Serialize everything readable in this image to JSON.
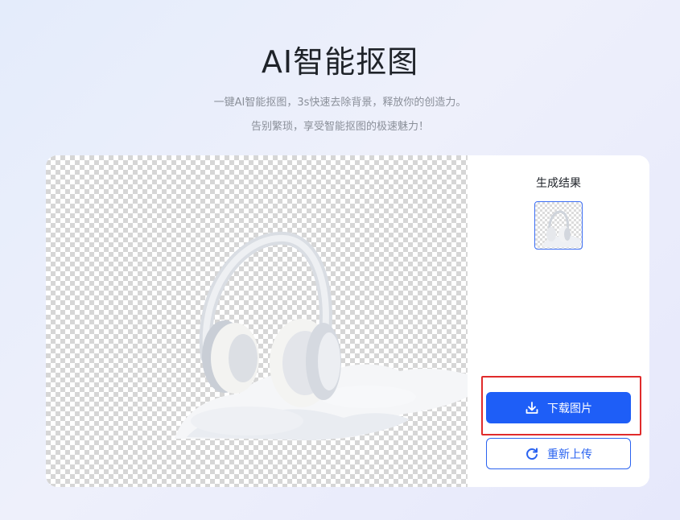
{
  "page": {
    "title": "AI智能抠图",
    "subtitle_line1": "一键AI智能抠图，3s快速去除背景，释放你的创造力。",
    "subtitle_line2": "告别繁琐，享受智能抠图的极速魅力！"
  },
  "result_panel": {
    "title": "生成结果",
    "thumbnail_icon": "headphones-result-thumbnail"
  },
  "actions": {
    "download_label": "下载图片",
    "download_icon": "download-icon",
    "reupload_label": "重新上传",
    "reupload_icon": "refresh-icon"
  },
  "colors": {
    "primary": "#1e5ef7",
    "highlight": "#e02b2b",
    "checker": "#d6d6d6"
  }
}
